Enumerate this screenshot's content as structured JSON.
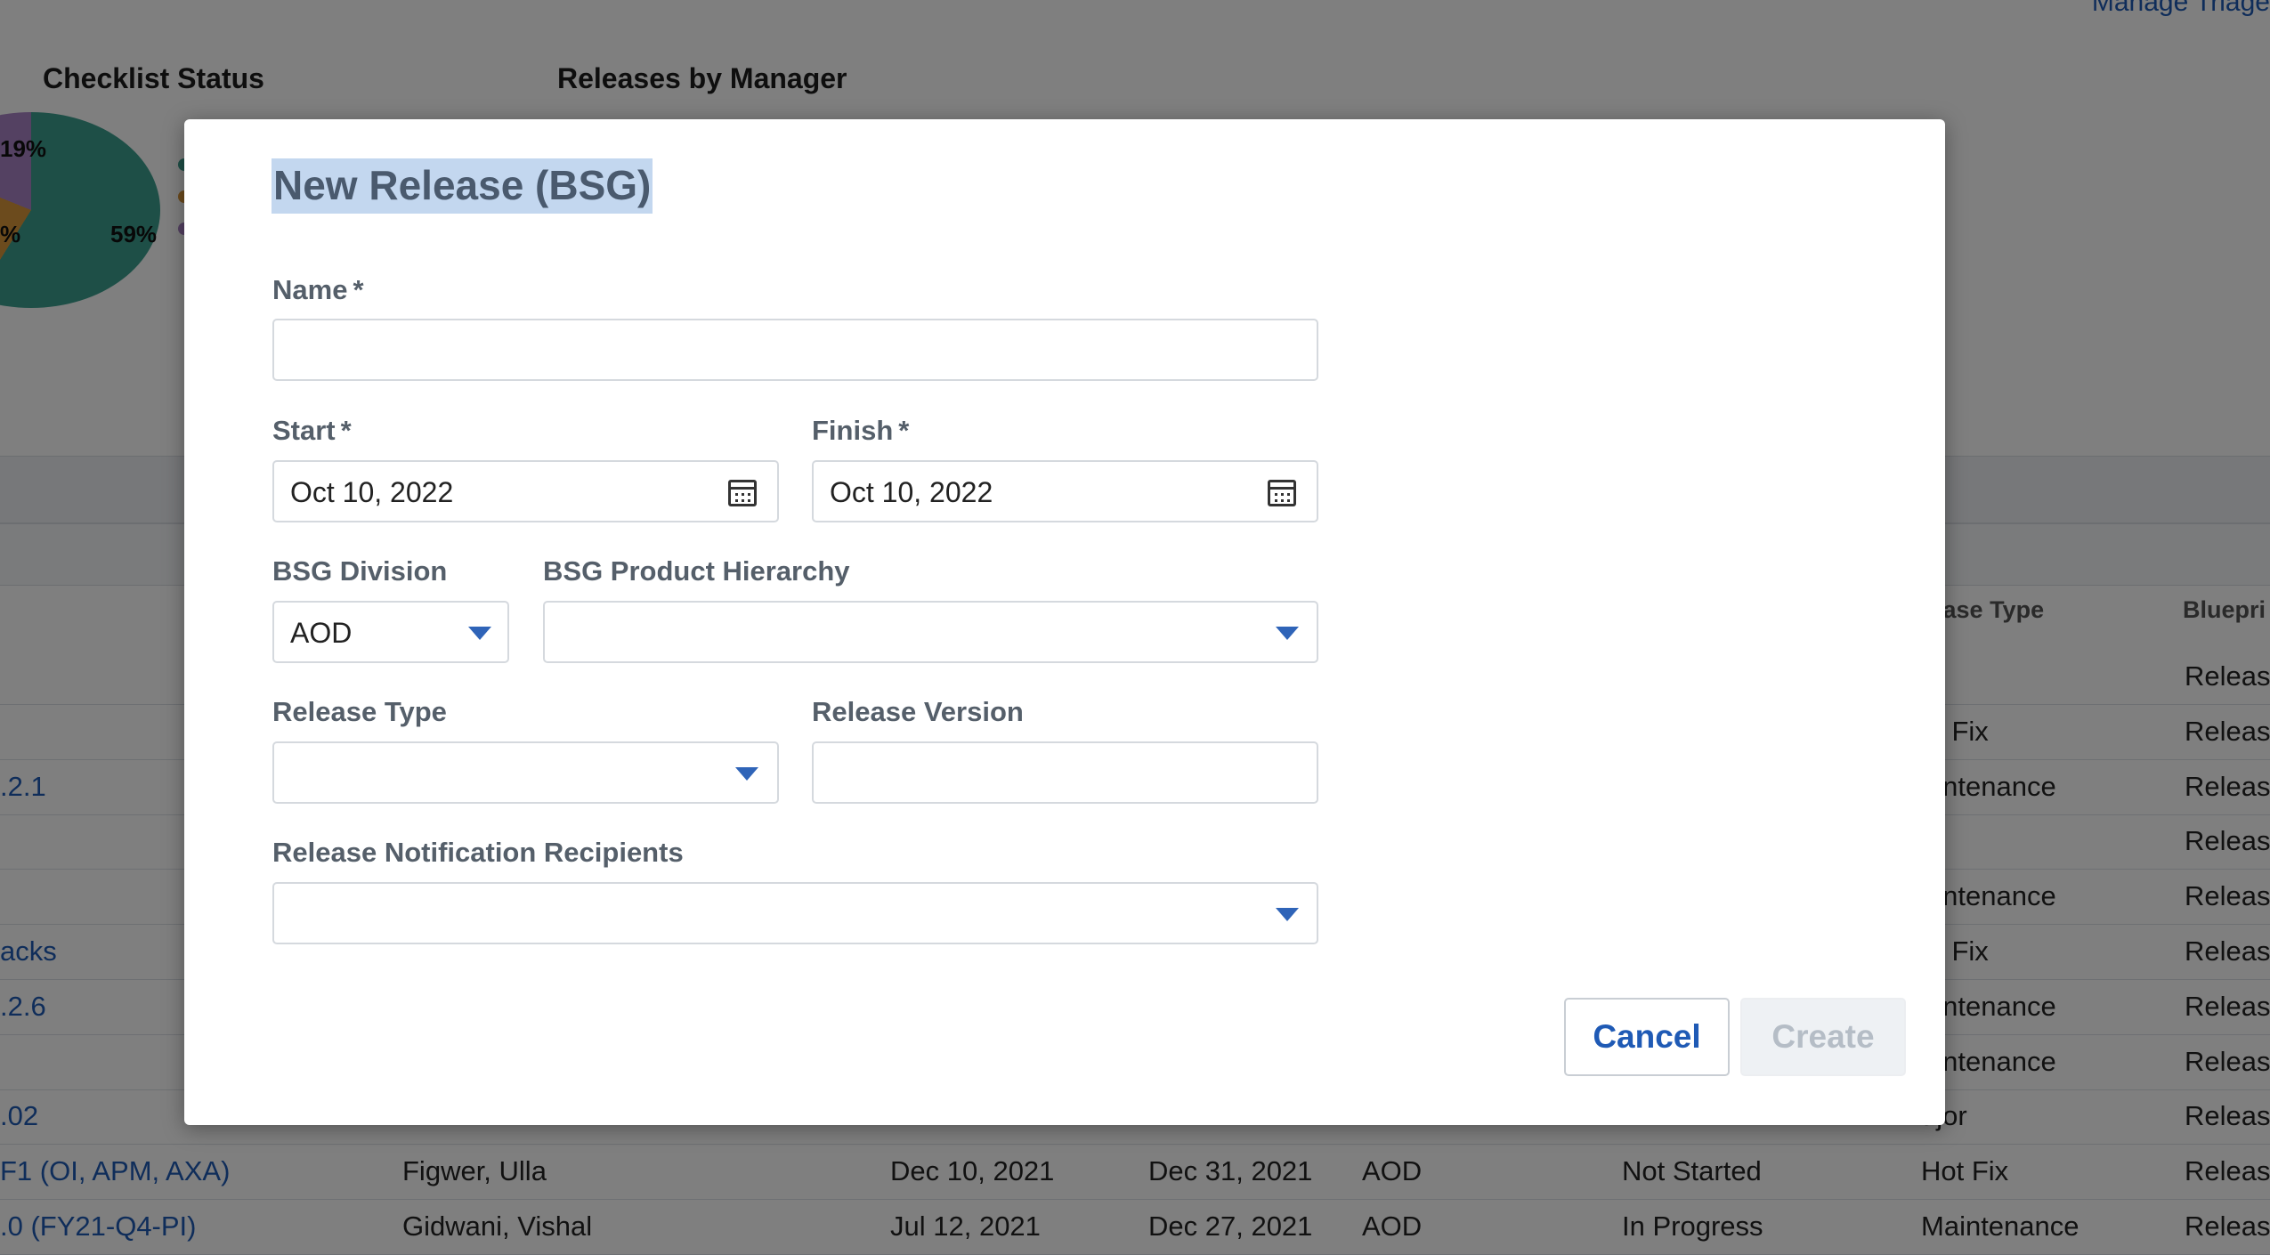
{
  "background": {
    "top_link": "Manage Triage",
    "checklist_status": {
      "title": "Checklist Status",
      "slices": [
        {
          "label": "59%",
          "value": 59,
          "color": "#3c9e8e"
        },
        {
          "label": "%",
          "value": 22,
          "color": "#d9963a"
        },
        {
          "label": "19%",
          "value": 19,
          "color": "#a882c4"
        }
      ]
    },
    "releases_by_manager_title": "Releases by Manager",
    "table_headers": {
      "release_type": "lease Type",
      "blueprint": "Bluepri"
    },
    "rows": [
      {
        "name": "",
        "manager": "",
        "start": "",
        "finish": "",
        "division": "",
        "status": "",
        "type": "",
        "blueprint": "Releas"
      },
      {
        "name": "",
        "manager": "",
        "start": "",
        "finish": "",
        "division": "",
        "status": "",
        "type": "ot Fix",
        "blueprint": "Releas"
      },
      {
        "name": ".2.1",
        "manager": "",
        "start": "",
        "finish": "",
        "division": "",
        "status": "",
        "type": "aintenance",
        "blueprint": "Releas"
      },
      {
        "name": "",
        "manager": "",
        "start": "",
        "finish": "",
        "division": "",
        "status": "",
        "type": "",
        "blueprint": "Releas"
      },
      {
        "name": "",
        "manager": "",
        "start": "",
        "finish": "",
        "division": "",
        "status": "",
        "type": "aintenance",
        "blueprint": "Releas"
      },
      {
        "name": "acks",
        "manager": "",
        "start": "",
        "finish": "",
        "division": "",
        "status": "",
        "type": "ot Fix",
        "blueprint": "Releas"
      },
      {
        "name": ".2.6",
        "manager": "",
        "start": "",
        "finish": "",
        "division": "",
        "status": "",
        "type": "aintenance",
        "blueprint": "Releas"
      },
      {
        "name": "",
        "manager": "",
        "start": "",
        "finish": "",
        "division": "",
        "status": "",
        "type": "aintenance",
        "blueprint": "Releas"
      },
      {
        "name": ".02",
        "manager": "",
        "start": "",
        "finish": "",
        "division": "",
        "status": "",
        "type": "ajor",
        "blueprint": "Releas"
      },
      {
        "name": "F1 (OI, APM, AXA)",
        "manager": "Figwer, Ulla",
        "start": "Dec 10, 2021",
        "finish": "Dec 31, 2021",
        "division": "AOD",
        "status": "Not Started",
        "type": "Hot Fix",
        "blueprint": "Releas"
      },
      {
        "name": ".0 (FY21-Q4-PI)",
        "manager": "Gidwani, Vishal",
        "start": "Jul 12, 2021",
        "finish": "Dec 27, 2021",
        "division": "AOD",
        "status": "In Progress",
        "type": "Maintenance",
        "blueprint": "Releas"
      }
    ]
  },
  "modal": {
    "title": "New Release (BSG)",
    "required_marker": "*",
    "name": {
      "label": "Name",
      "value": ""
    },
    "start": {
      "label": "Start",
      "value": "Oct 10, 2022"
    },
    "finish": {
      "label": "Finish",
      "value": "Oct 10, 2022"
    },
    "division": {
      "label": "BSG Division",
      "value": "AOD"
    },
    "product_hierarchy": {
      "label": "BSG Product Hierarchy",
      "value": ""
    },
    "release_type": {
      "label": "Release Type",
      "value": ""
    },
    "release_version": {
      "label": "Release Version",
      "value": ""
    },
    "recipients": {
      "label": "Release Notification Recipients",
      "value": ""
    },
    "cancel_label": "Cancel",
    "create_label": "Create"
  },
  "colors": {
    "accent": "#2f64b8",
    "link": "#1f5ab5",
    "overlay": "rgba(0,0,0,0.5)"
  }
}
